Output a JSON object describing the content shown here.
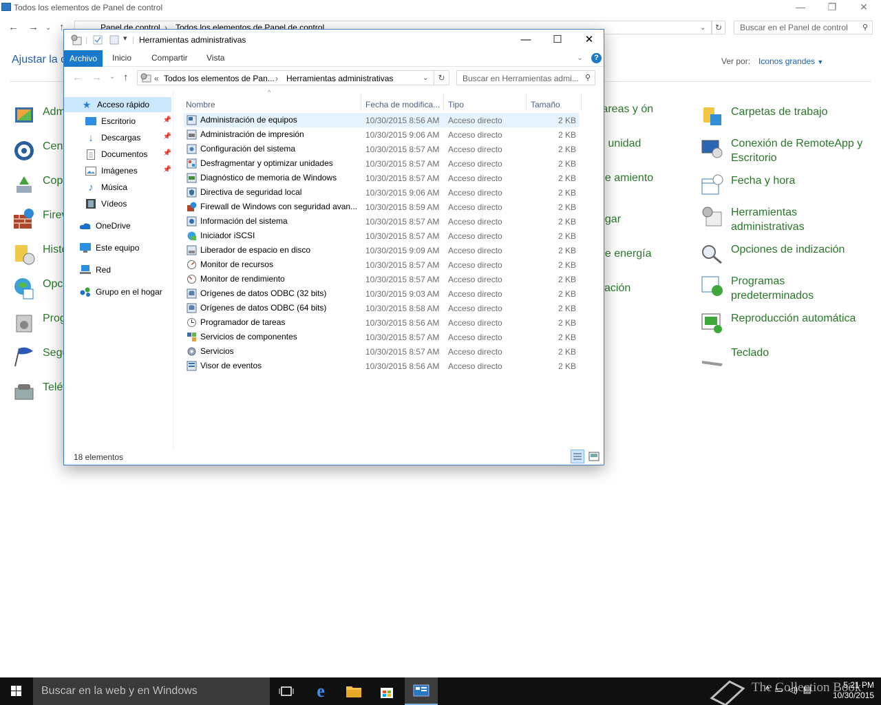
{
  "control_panel": {
    "title": "Todos los elementos de Panel de control",
    "breadcrumb": [
      "Panel de control",
      "Todos los elementos de Panel de control"
    ],
    "search_placeholder": "Buscar en el Panel de control",
    "heading": "Ajustar la c",
    "view_by_label": "Ver por:",
    "view_by_value": "Iconos grandes",
    "left_items": [
      "Adm",
      "Cent",
      "Copi resta",
      "Firev",
      "Histo",
      "Opci",
      "Prog cara",
      "Segu man",
      "Teléf"
    ],
    "mid_items": [
      "tareas y ón",
      "e unidad",
      "de amiento",
      "ogar",
      "de energía",
      "zación"
    ],
    "right_items": [
      "Carpetas de trabajo",
      "Conexión de RemoteApp y Escritorio",
      "Fecha y hora",
      "Herramientas administrativas",
      "Opciones de indización",
      "Programas predeterminados",
      "Reproducción automática",
      "Teclado"
    ]
  },
  "explorer": {
    "title": "Herramientas administrativas",
    "ribbon_tabs": [
      "Archivo",
      "Inicio",
      "Compartir",
      "Vista"
    ],
    "address": {
      "prefix": "«",
      "crumbs": [
        "Todos los elementos de Pan...",
        "Herramientas administrativas"
      ]
    },
    "search_placeholder": "Buscar en Herramientas admi...",
    "nav": [
      "Acceso rápido",
      "Escritorio",
      "Descargas",
      "Documentos",
      "Imágenes",
      "Música",
      "Vídeos",
      "OneDrive",
      "Este equipo",
      "Red",
      "Grupo en el hogar"
    ],
    "columns": [
      "Nombre",
      "Fecha de modifica...",
      "Tipo",
      "Tamaño"
    ],
    "files": [
      [
        "Administración de equipos",
        "10/30/2015 8:56 AM",
        "Acceso directo",
        "2 KB"
      ],
      [
        "Administración de impresión",
        "10/30/2015 9:06 AM",
        "Acceso directo",
        "2 KB"
      ],
      [
        "Configuración del sistema",
        "10/30/2015 8:57 AM",
        "Acceso directo",
        "2 KB"
      ],
      [
        "Desfragmentar y optimizar unidades",
        "10/30/2015 8:57 AM",
        "Acceso directo",
        "2 KB"
      ],
      [
        "Diagnóstico de memoria de Windows",
        "10/30/2015 8:57 AM",
        "Acceso directo",
        "2 KB"
      ],
      [
        "Directiva de seguridad local",
        "10/30/2015 9:06 AM",
        "Acceso directo",
        "2 KB"
      ],
      [
        "Firewall de Windows con seguridad avan...",
        "10/30/2015 8:59 AM",
        "Acceso directo",
        "2 KB"
      ],
      [
        "Información del sistema",
        "10/30/2015 8:57 AM",
        "Acceso directo",
        "2 KB"
      ],
      [
        "Iniciador iSCSI",
        "10/30/2015 8:57 AM",
        "Acceso directo",
        "2 KB"
      ],
      [
        "Liberador de espacio en disco",
        "10/30/2015 9:09 AM",
        "Acceso directo",
        "2 KB"
      ],
      [
        "Monitor de recursos",
        "10/30/2015 8:57 AM",
        "Acceso directo",
        "2 KB"
      ],
      [
        "Monitor de rendimiento",
        "10/30/2015 8:57 AM",
        "Acceso directo",
        "2 KB"
      ],
      [
        "Orígenes de datos ODBC (32 bits)",
        "10/30/2015 9:03 AM",
        "Acceso directo",
        "2 KB"
      ],
      [
        "Orígenes de datos ODBC (64 bits)",
        "10/30/2015 8:58 AM",
        "Acceso directo",
        "2 KB"
      ],
      [
        "Programador de tareas",
        "10/30/2015 8:56 AM",
        "Acceso directo",
        "2 KB"
      ],
      [
        "Servicios de componentes",
        "10/30/2015 8:57 AM",
        "Acceso directo",
        "2 KB"
      ],
      [
        "Servicios",
        "10/30/2015 8:57 AM",
        "Acceso directo",
        "2 KB"
      ],
      [
        "Visor de eventos",
        "10/30/2015 8:56 AM",
        "Acceso directo",
        "2 KB"
      ]
    ],
    "status": "18 elementos"
  },
  "taskbar": {
    "search_placeholder": "Buscar en la web y en Windows",
    "time": "5:21 PM",
    "date": "10/30/2015",
    "watermark": "The Collection Book"
  },
  "colors": {
    "accent": "#1979ca",
    "link_green": "#287728",
    "link_blue": "#1e5fa8",
    "selection": "#cce8ff"
  }
}
